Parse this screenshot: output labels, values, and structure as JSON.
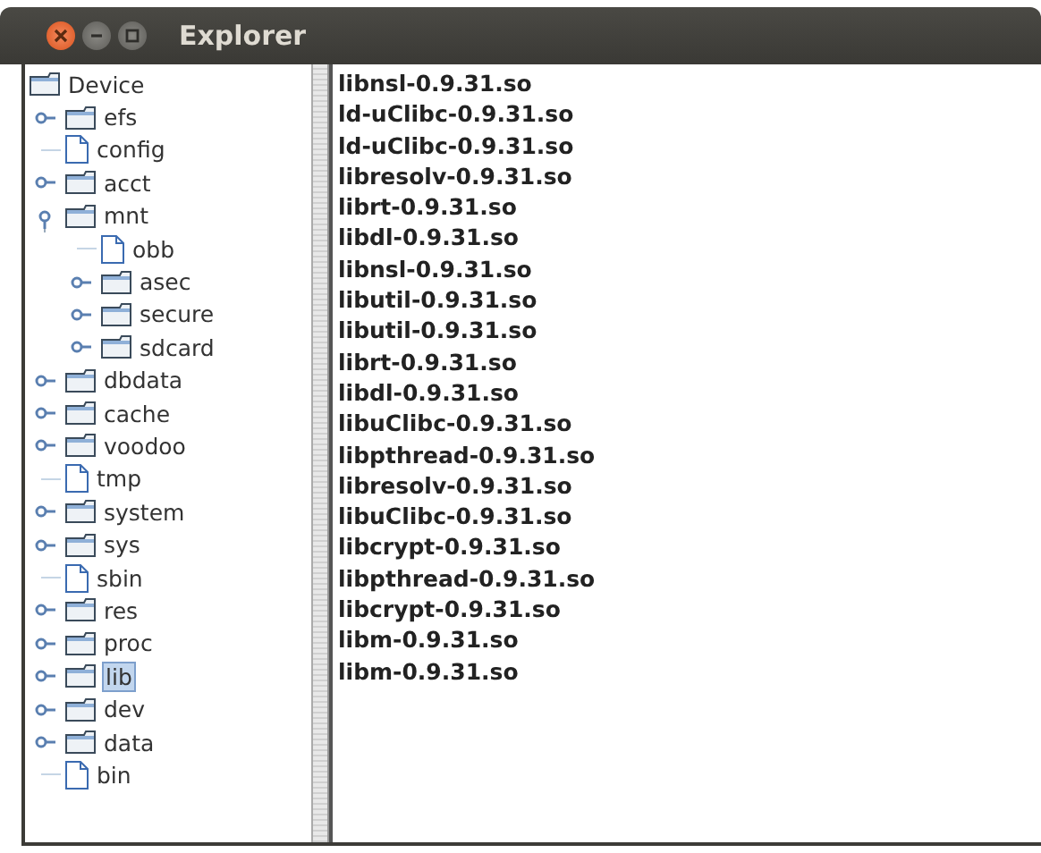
{
  "window": {
    "title": "Explorer"
  },
  "tree": {
    "label": "Device",
    "kind": "folder",
    "selected": false,
    "children": [
      {
        "label": "efs",
        "kind": "folder",
        "expanded": false,
        "selected": false
      },
      {
        "label": "config",
        "kind": "file",
        "selected": false
      },
      {
        "label": "acct",
        "kind": "folder",
        "expanded": false,
        "selected": false
      },
      {
        "label": "mnt",
        "kind": "folder",
        "expanded": true,
        "selected": false,
        "children": [
          {
            "label": "obb",
            "kind": "file",
            "selected": false
          },
          {
            "label": "asec",
            "kind": "folder",
            "expanded": false,
            "selected": false
          },
          {
            "label": "secure",
            "kind": "folder",
            "expanded": false,
            "selected": false
          },
          {
            "label": "sdcard",
            "kind": "folder",
            "expanded": false,
            "selected": false
          }
        ]
      },
      {
        "label": "dbdata",
        "kind": "folder",
        "expanded": false,
        "selected": false
      },
      {
        "label": "cache",
        "kind": "folder",
        "expanded": false,
        "selected": false
      },
      {
        "label": "voodoo",
        "kind": "folder",
        "expanded": false,
        "selected": false
      },
      {
        "label": "tmp",
        "kind": "file",
        "selected": false
      },
      {
        "label": "system",
        "kind": "folder",
        "expanded": false,
        "selected": false
      },
      {
        "label": "sys",
        "kind": "folder",
        "expanded": false,
        "selected": false
      },
      {
        "label": "sbin",
        "kind": "file",
        "selected": false
      },
      {
        "label": "res",
        "kind": "folder",
        "expanded": false,
        "selected": false
      },
      {
        "label": "proc",
        "kind": "folder",
        "expanded": false,
        "selected": false
      },
      {
        "label": "lib",
        "kind": "folder",
        "expanded": false,
        "selected": true
      },
      {
        "label": "dev",
        "kind": "folder",
        "expanded": false,
        "selected": false
      },
      {
        "label": "data",
        "kind": "folder",
        "expanded": false,
        "selected": false
      },
      {
        "label": "bin",
        "kind": "file",
        "selected": false
      }
    ]
  },
  "files": [
    "libnsl-0.9.31.so",
    "ld-uClibc-0.9.31.so",
    "ld-uClibc-0.9.31.so",
    "libresolv-0.9.31.so",
    "librt-0.9.31.so",
    "libdl-0.9.31.so",
    "libnsl-0.9.31.so",
    "libutil-0.9.31.so",
    "libutil-0.9.31.so",
    "librt-0.9.31.so",
    "libdl-0.9.31.so",
    "libuClibc-0.9.31.so",
    "libpthread-0.9.31.so",
    "libresolv-0.9.31.so",
    "libuClibc-0.9.31.so",
    "libcrypt-0.9.31.so",
    "libpthread-0.9.31.so",
    "libcrypt-0.9.31.so",
    "libm-0.9.31.so",
    "libm-0.9.31.so"
  ]
}
